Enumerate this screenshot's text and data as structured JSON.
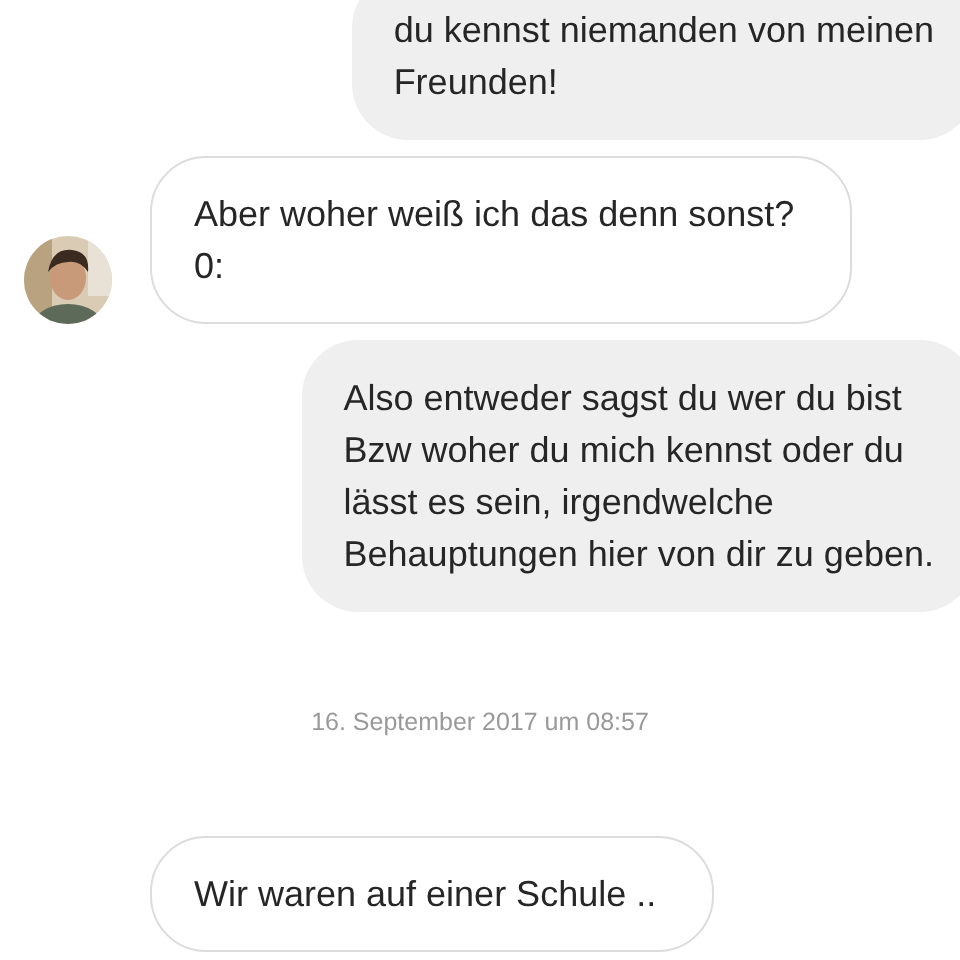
{
  "messages": [
    {
      "kind": "sent",
      "text": "du kennst niemanden von meinen\nFreunden!"
    },
    {
      "kind": "received",
      "text": "Aber woher weiß ich das denn sonst?\n0:",
      "avatar": true
    },
    {
      "kind": "sent",
      "text": "Also entweder sagst du wer du bist\nBzw woher du mich kennst oder du\nlässt es sein, irgendwelche\nBehauptungen hier von dir zu geben."
    },
    {
      "kind": "timestamp",
      "text": "16. September 2017 um 08:57"
    },
    {
      "kind": "received",
      "text": "Wir waren auf einer Schule ..",
      "avatar": false
    }
  ]
}
